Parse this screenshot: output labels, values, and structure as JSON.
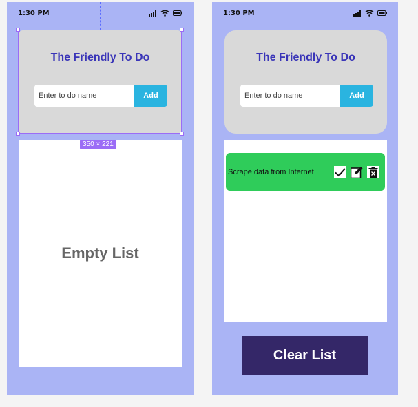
{
  "left_phone": {
    "status": {
      "time": "1:30 PM"
    },
    "header": {
      "title": "The Friendly To Do",
      "placeholder": "Enter to do name",
      "add_label": "Add"
    },
    "list": {
      "empty_text": "Empty List"
    },
    "selection": {
      "dimensions": "350 × 221"
    }
  },
  "right_phone": {
    "status": {
      "time": "1:30 PM"
    },
    "header": {
      "title": "The Friendly To Do",
      "placeholder": "Enter to do name",
      "add_label": "Add"
    },
    "list": {
      "items": [
        {
          "label": "Scrape data from Internet",
          "icons": [
            "check-icon",
            "edit-icon",
            "delete-icon"
          ]
        }
      ]
    },
    "clear_label": "Clear List"
  },
  "colors": {
    "phone_bg": "#aab4f5",
    "header_card": "#d9d9d9",
    "title": "#3a35b8",
    "add_button": "#2ab4e0",
    "todo_item": "#2fcc5a",
    "clear_button": "#342768",
    "selection": "#9b6cf6"
  }
}
